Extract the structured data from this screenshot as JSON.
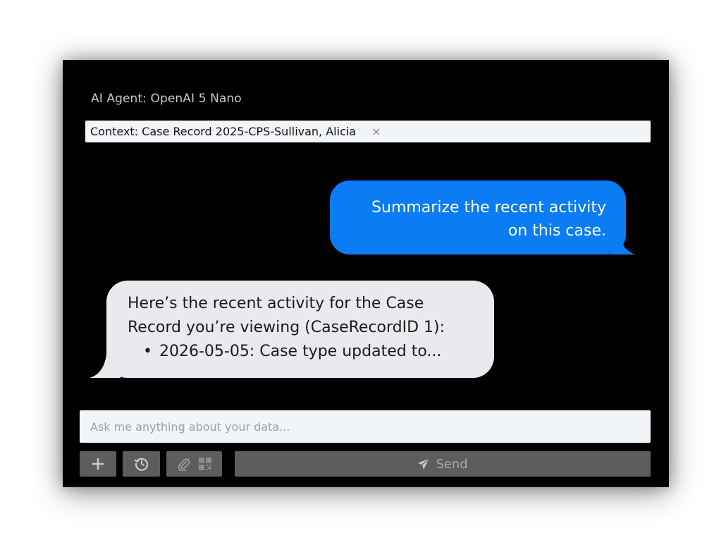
{
  "agent": {
    "title": "AI Agent: OpenAI 5 Nano"
  },
  "context": {
    "label": "Context: Case Record 2025-CPS-Sullivan, Alicia",
    "close_glyph": "×"
  },
  "messages": {
    "user": {
      "line1": "Summarize the recent activity",
      "line2": "on this case."
    },
    "assistant": {
      "line1": "Here’s the recent activity for the Case",
      "line2": "Record you’re viewing (CaseRecordID 1):",
      "bullet1": "2026-05-05: Case type updated to..."
    }
  },
  "composer": {
    "placeholder": "Ask me anything about your data..."
  },
  "toolbar": {
    "send_label": "Send",
    "icons": [
      "plus-icon",
      "history-icon",
      "paperclip-icon",
      "qr-code-icon",
      "send-icon"
    ]
  },
  "colors": {
    "panel_bg": "#000000",
    "user_bubble": "#0b7cf3",
    "assistant_bubble": "#e9eaee",
    "button_bg": "#5c5d5e"
  }
}
